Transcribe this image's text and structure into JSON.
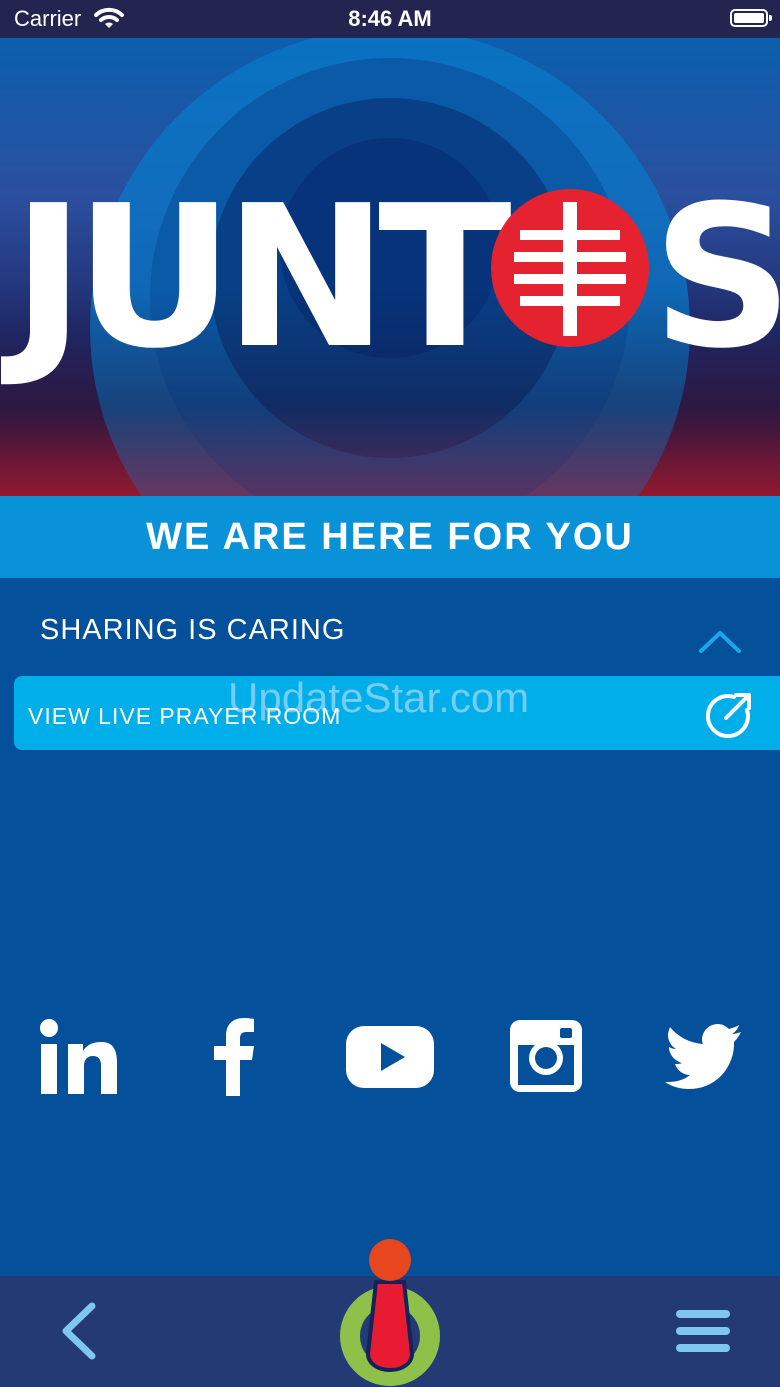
{
  "status_bar": {
    "carrier": "Carrier",
    "time": "8:46 AM"
  },
  "hero": {
    "logo_text": "JUNT",
    "logo_end": "S"
  },
  "tagline": "WE ARE HERE FOR YOU",
  "section": {
    "title": "SHARING IS CARING",
    "items": [
      {
        "label": "VIEW LIVE PRAYER ROOM"
      }
    ]
  },
  "watermark": "UpdateStar.com",
  "social": [
    "linkedin-icon",
    "facebook-icon",
    "youtube-icon",
    "instagram-icon",
    "twitter-icon"
  ],
  "colors": {
    "background": "#04509b",
    "tagline_bar": "#0a92d8",
    "prayer_bar": "#00aee9",
    "logo_red": "#e52230",
    "nav_bar": "#243a74"
  }
}
